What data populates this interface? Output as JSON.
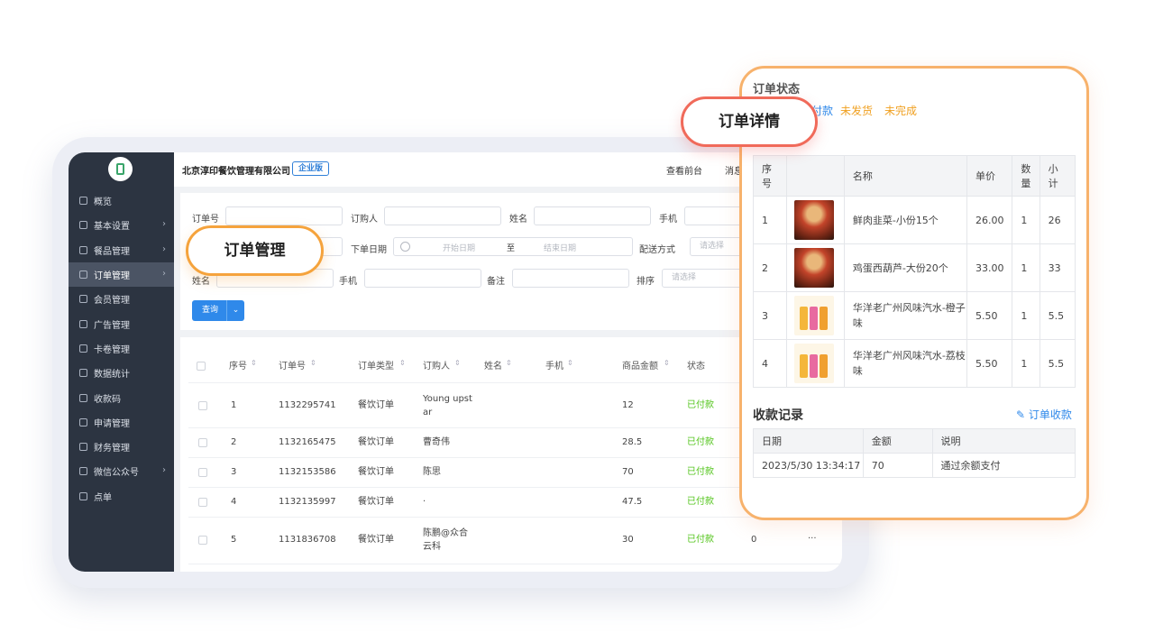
{
  "topbar": {
    "company": "北京淳印餐饮管理有限公司",
    "edition": "企业版",
    "front_link": "查看前台",
    "messages": "消息"
  },
  "sidebar": {
    "items": [
      {
        "label": "概览",
        "has_arrow": false,
        "active": false
      },
      {
        "label": "基本设置",
        "has_arrow": true,
        "active": false
      },
      {
        "label": "餐品管理",
        "has_arrow": true,
        "active": false
      },
      {
        "label": "订单管理",
        "has_arrow": true,
        "active": true
      },
      {
        "label": "会员管理",
        "has_arrow": false,
        "active": false
      },
      {
        "label": "广告管理",
        "has_arrow": false,
        "active": false
      },
      {
        "label": "卡卷管理",
        "has_arrow": false,
        "active": false
      },
      {
        "label": "数据统计",
        "has_arrow": false,
        "active": false
      },
      {
        "label": "收款码",
        "has_arrow": false,
        "active": false
      },
      {
        "label": "申请管理",
        "has_arrow": false,
        "active": false
      },
      {
        "label": "财务管理",
        "has_arrow": false,
        "active": false
      },
      {
        "label": "微信公众号",
        "has_arrow": true,
        "active": false
      },
      {
        "label": "点单",
        "has_arrow": false,
        "active": false
      }
    ]
  },
  "filters": {
    "order_no": "订单号",
    "buyer": "订购人",
    "name": "姓名",
    "phone": "手机",
    "order_date": "下单日期",
    "start_date": "开始日期",
    "to": "至",
    "end_date": "结束日期",
    "delivery": "配送方式",
    "select_placeholder": "请选择",
    "name2": "姓名",
    "phone2": "手机",
    "remark": "备注",
    "sort": "排序",
    "query_button": "查询"
  },
  "orders": {
    "columns": [
      "序号",
      "订单号",
      "订单类型",
      "订购人",
      "姓名",
      "手机",
      "商品金额",
      "状态"
    ],
    "rows": [
      {
        "index": "1",
        "order_no": "1132295741",
        "type": "餐饮订单",
        "buyer": "Young upst\nar",
        "amount": "12",
        "status": "已付款",
        "extra": ""
      },
      {
        "index": "2",
        "order_no": "1132165475",
        "type": "餐饮订单",
        "buyer": "曹奇伟",
        "amount": "28.5",
        "status": "已付款",
        "extra": ""
      },
      {
        "index": "3",
        "order_no": "1132153586",
        "type": "餐饮订单",
        "buyer": "陈思",
        "amount": "70",
        "status": "已付款",
        "extra": ""
      },
      {
        "index": "4",
        "order_no": "1132135997",
        "type": "餐饮订单",
        "buyer": "·",
        "amount": "47.5",
        "status": "已付款",
        "extra": ""
      },
      {
        "index": "5",
        "order_no": "1131836708",
        "type": "餐饮订单",
        "buyer": "陈鹏@众合\n云科",
        "amount": "30",
        "status": "已付款",
        "extra": "0"
      }
    ],
    "more": "···"
  },
  "detail": {
    "title": "订单状态",
    "status_paid": "付款",
    "status_unshipped": "未发货",
    "status_unfinished": "未完成",
    "columns": [
      "序\n号",
      "",
      "名称",
      "单价",
      "数\n量",
      "小\n计"
    ],
    "items": [
      {
        "index": "1",
        "name": "鲜肉韭菜-小份15个",
        "price": "26.00",
        "qty": "1",
        "subtotal": "26",
        "image": "dumplings"
      },
      {
        "index": "2",
        "name": "鸡蛋西葫芦-大份20个",
        "price": "33.00",
        "qty": "1",
        "subtotal": "33",
        "image": "dumplings"
      },
      {
        "index": "3",
        "name": "华洋老广州风味汽水-橙子味",
        "price": "5.50",
        "qty": "1",
        "subtotal": "5.5",
        "image": "soda-cans"
      },
      {
        "index": "4",
        "name": "华洋老广州风味汽水-荔枝味",
        "price": "5.50",
        "qty": "1",
        "subtotal": "5.5",
        "image": "soda-cans"
      }
    ],
    "payment_title": "收款记录",
    "payment_action": "订单收款",
    "payment_columns": [
      "日期",
      "金额",
      "说明"
    ],
    "payments": [
      {
        "date": "2023/5/30 13:34:17",
        "amount": "70",
        "note": "通过余额支付"
      }
    ]
  },
  "callouts": {
    "order_detail": "订单详情",
    "order_management": "订单管理"
  },
  "colors": {
    "sidebar": "#2c3441",
    "primary": "#2f89ea",
    "paid": "#52c41a",
    "warning": "#f0a020",
    "detail_border": "#f7b26c"
  }
}
